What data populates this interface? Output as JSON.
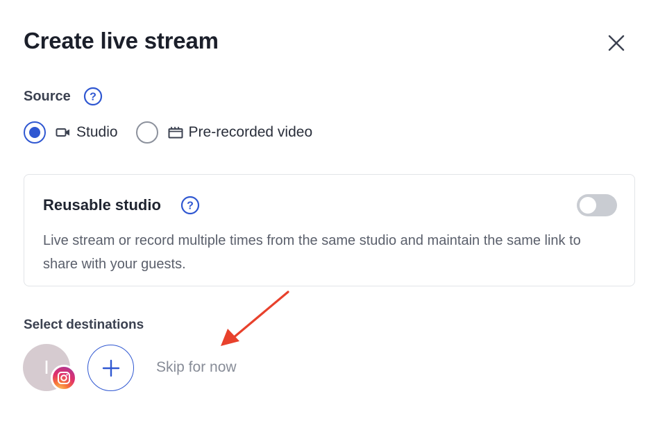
{
  "modal": {
    "title": "Create live stream",
    "close_icon": "close-icon"
  },
  "source": {
    "label": "Source",
    "help_icon": "question-circle-icon",
    "options": [
      {
        "label": "Studio",
        "icon": "video-camera-icon",
        "selected": true
      },
      {
        "label": "Pre-recorded video",
        "icon": "clapperboard-icon",
        "selected": false
      }
    ]
  },
  "reusable_studio": {
    "title": "Reusable studio",
    "help_icon": "question-circle-icon",
    "enabled": false,
    "description": "Live stream or record multiple times from the same studio and maintain the same link to share with your guests."
  },
  "destinations": {
    "label": "Select destinations",
    "avatar_letter": "I",
    "badge_icon": "instagram-icon",
    "add_icon": "plus-icon",
    "skip_label": "Skip for now"
  },
  "colors": {
    "accent": "#2f57d1",
    "annotation_arrow": "#e8412c"
  }
}
